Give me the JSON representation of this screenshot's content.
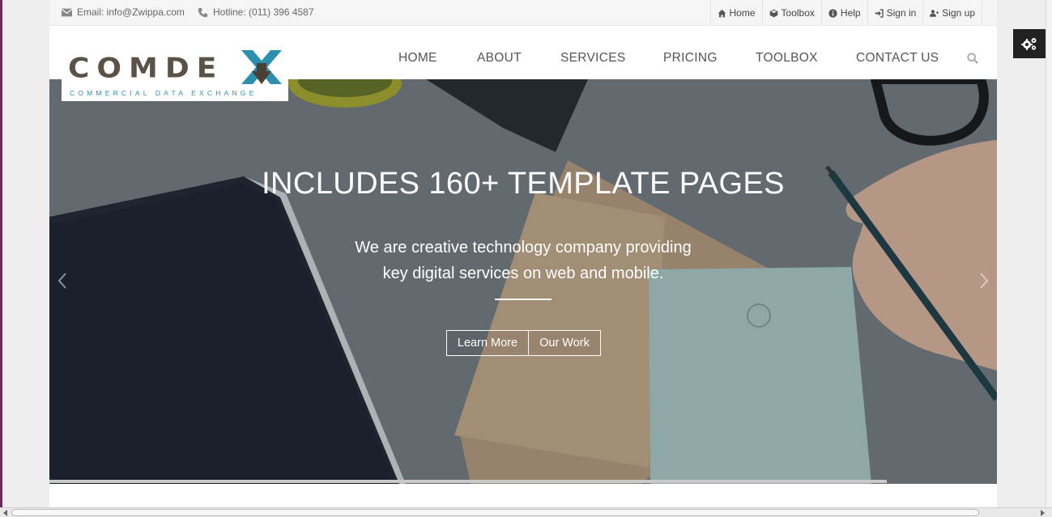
{
  "topbar": {
    "email": "Email: info@Zwippa.com",
    "hotline": "Hotline: (011) 396 4587",
    "links": [
      {
        "label": "Home",
        "icon": "home-icon"
      },
      {
        "label": "Toolbox",
        "icon": "cube-icon"
      },
      {
        "label": "Help",
        "icon": "info-icon"
      },
      {
        "label": "Sign in",
        "icon": "sign-in-icon"
      },
      {
        "label": "Sign up",
        "icon": "user-plus-icon"
      }
    ]
  },
  "logo": {
    "name": "COMDEX",
    "tagline": "COMMERCIAL DATA EXCHANGE"
  },
  "nav": {
    "items": [
      "HOME",
      "ABOUT",
      "SERVICES",
      "PRICING",
      "TOOLBOX",
      "CONTACT US"
    ]
  },
  "hero": {
    "title": "INCLUDES 160+ TEMPLATE PAGES",
    "subtitle_line1": "We are creative technology company providing",
    "subtitle_line2": "key digital services on web and mobile.",
    "button_primary": "Learn More",
    "button_secondary": "Our Work"
  },
  "colors": {
    "logo_dark": "#5b5247",
    "logo_accent": "#2d8fb0",
    "text_gray": "#555555",
    "settings_bg": "#222222"
  }
}
